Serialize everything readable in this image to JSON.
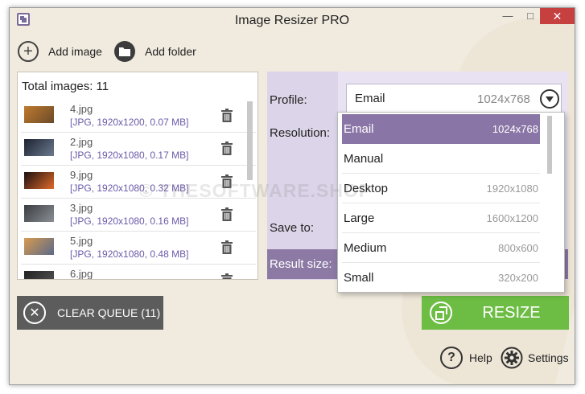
{
  "window": {
    "title": "Image Resizer PRO",
    "minimize_glyph": "—",
    "maximize_glyph": "□",
    "close_glyph": "✕"
  },
  "toolbar": {
    "add_image_label": "Add image",
    "add_image_icon": "plus-circle-icon",
    "add_folder_label": "Add folder",
    "add_folder_icon": "folder-icon"
  },
  "queue": {
    "total_label": "Total images: 11",
    "items": [
      {
        "name": "4.jpg",
        "meta": "[JPG, 1920x1200, 0.07 MB]",
        "thumb_colors": [
          "#c07a2e",
          "#6a4a2a"
        ]
      },
      {
        "name": "2.jpg",
        "meta": "[JPG, 1920x1080, 0.17 MB]",
        "thumb_colors": [
          "#1d2230",
          "#6b7a90"
        ]
      },
      {
        "name": "9.jpg",
        "meta": "[JPG, 1920x1080, 0.32 MB]",
        "thumb_colors": [
          "#1a1010",
          "#e06a2a"
        ]
      },
      {
        "name": "3.jpg",
        "meta": "[JPG, 1920x1080, 0.16 MB]",
        "thumb_colors": [
          "#3a3d40",
          "#8a8f95"
        ]
      },
      {
        "name": "5.jpg",
        "meta": "[JPG, 1920x1080, 0.48 MB]",
        "thumb_colors": [
          "#d89a50",
          "#5a6a8a"
        ]
      },
      {
        "name": "6.jpg",
        "meta": "",
        "thumb_colors": [
          "#222",
          "#555"
        ]
      }
    ]
  },
  "settings": {
    "profile_label": "Profile:",
    "resolution_label": "Resolution:",
    "save_to_label": "Save to:",
    "result_size_label": "Result size:",
    "profile_value": "Email",
    "profile_size": "1024x768"
  },
  "profile_dropdown": {
    "options": [
      {
        "name": "Email",
        "size": "1024x768",
        "selected": true
      },
      {
        "name": "Manual",
        "size": "",
        "selected": false
      },
      {
        "name": "Desktop",
        "size": "1920x1080",
        "selected": false
      },
      {
        "name": "Large",
        "size": "1600x1200",
        "selected": false
      },
      {
        "name": "Medium",
        "size": "800x600",
        "selected": false
      },
      {
        "name": "Small",
        "size": "320x200",
        "selected": false
      }
    ]
  },
  "actions": {
    "clear_queue_label": "CLEAR QUEUE (11)",
    "resize_label": "RESIZE",
    "help_label": "Help",
    "settings_label": "Settings"
  },
  "watermark": "© THESOFTWARE.SHOP",
  "colors": {
    "accent_purple": "#8a76a6",
    "resize_green": "#6dbd45",
    "clear_gray": "#5c5c5c",
    "close_red": "#c74040"
  }
}
